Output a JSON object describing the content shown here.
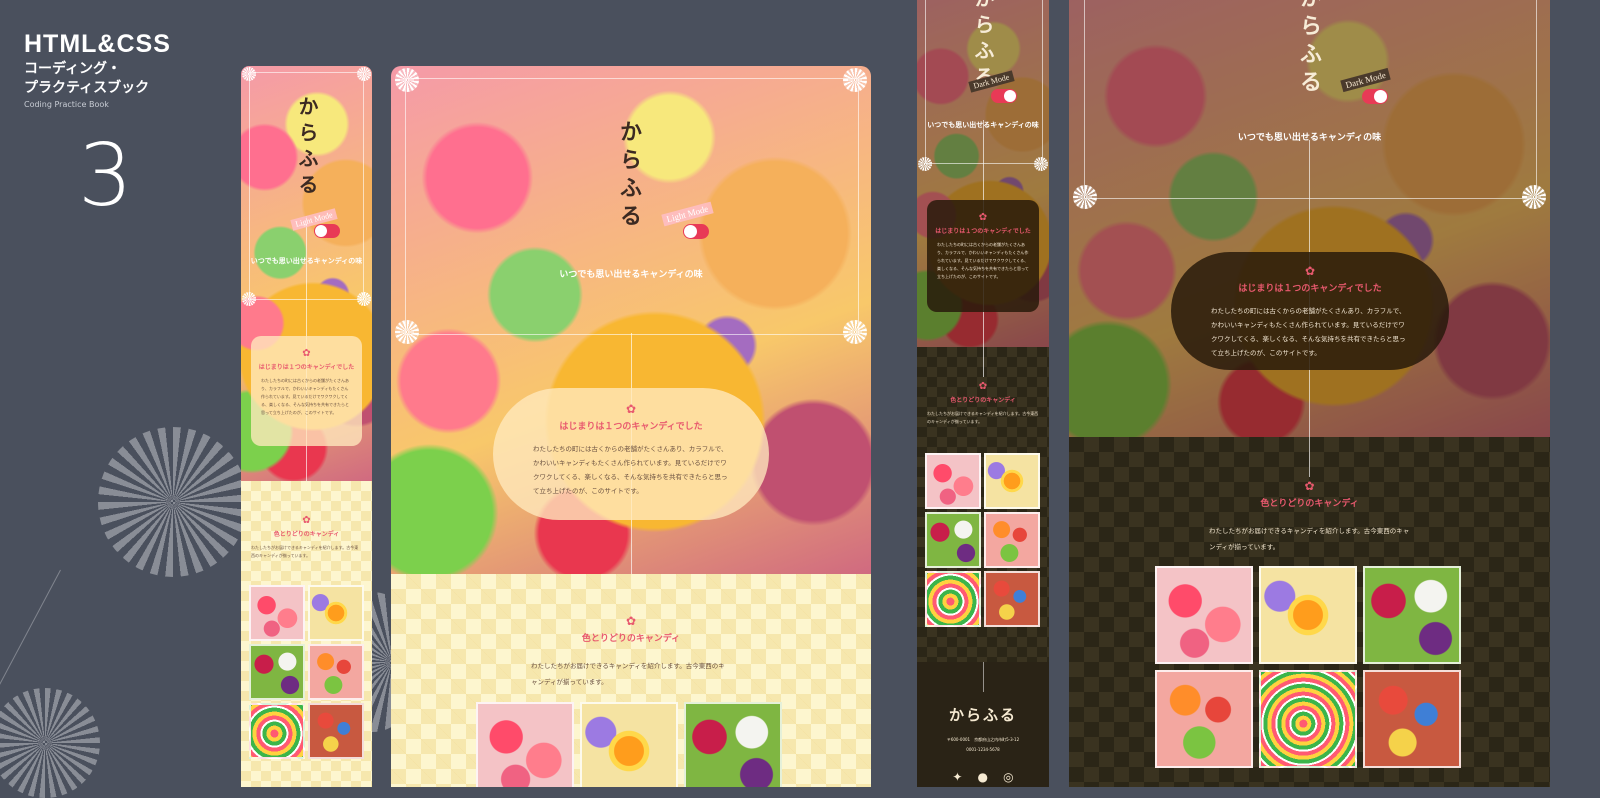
{
  "book": {
    "title": "HTML&CSS",
    "subtitle_line1": "コーディング・",
    "subtitle_line2": "プラクティスブック",
    "subtitle_en": "Coding Practice Book",
    "number": "3"
  },
  "site": {
    "logo": "からふる",
    "tagline": "いつでも思い出せるキャンディの味",
    "light_mode_label": "Light Mode",
    "dark_mode_label": "Dark Mode",
    "intro": {
      "icon": "candy-icon",
      "title": "はじまりは１つのキャンディでした",
      "body": "わたしたちの町には古くからの老舗がたくさんあり、カラフルで、かわいいキャンディもたくさん作られています。見ているだけでワクワクしてくる、楽しくなる、そんな気持ちを共有できたらと思って立ち上げたのが、このサイトです。"
    },
    "colors_section": {
      "icon": "candy-icon",
      "title": "色とりどりのキャンディ",
      "body": "わたしたちがお届けできるキャンディを紹介します。古今東西のキャンディが揃っています。"
    },
    "footer": {
      "logo": "からふる",
      "address": "〒600-0001　京都府山之内市町5-3-12",
      "phone": "0001-1234-5678",
      "social": [
        "twitter-icon",
        "facebook-icon",
        "instagram-icon"
      ]
    }
  },
  "colors": {
    "accent": "#e8596e",
    "background": "#4a505d",
    "light_check": "#fdf6cf",
    "dark_check": "#2b2617"
  }
}
